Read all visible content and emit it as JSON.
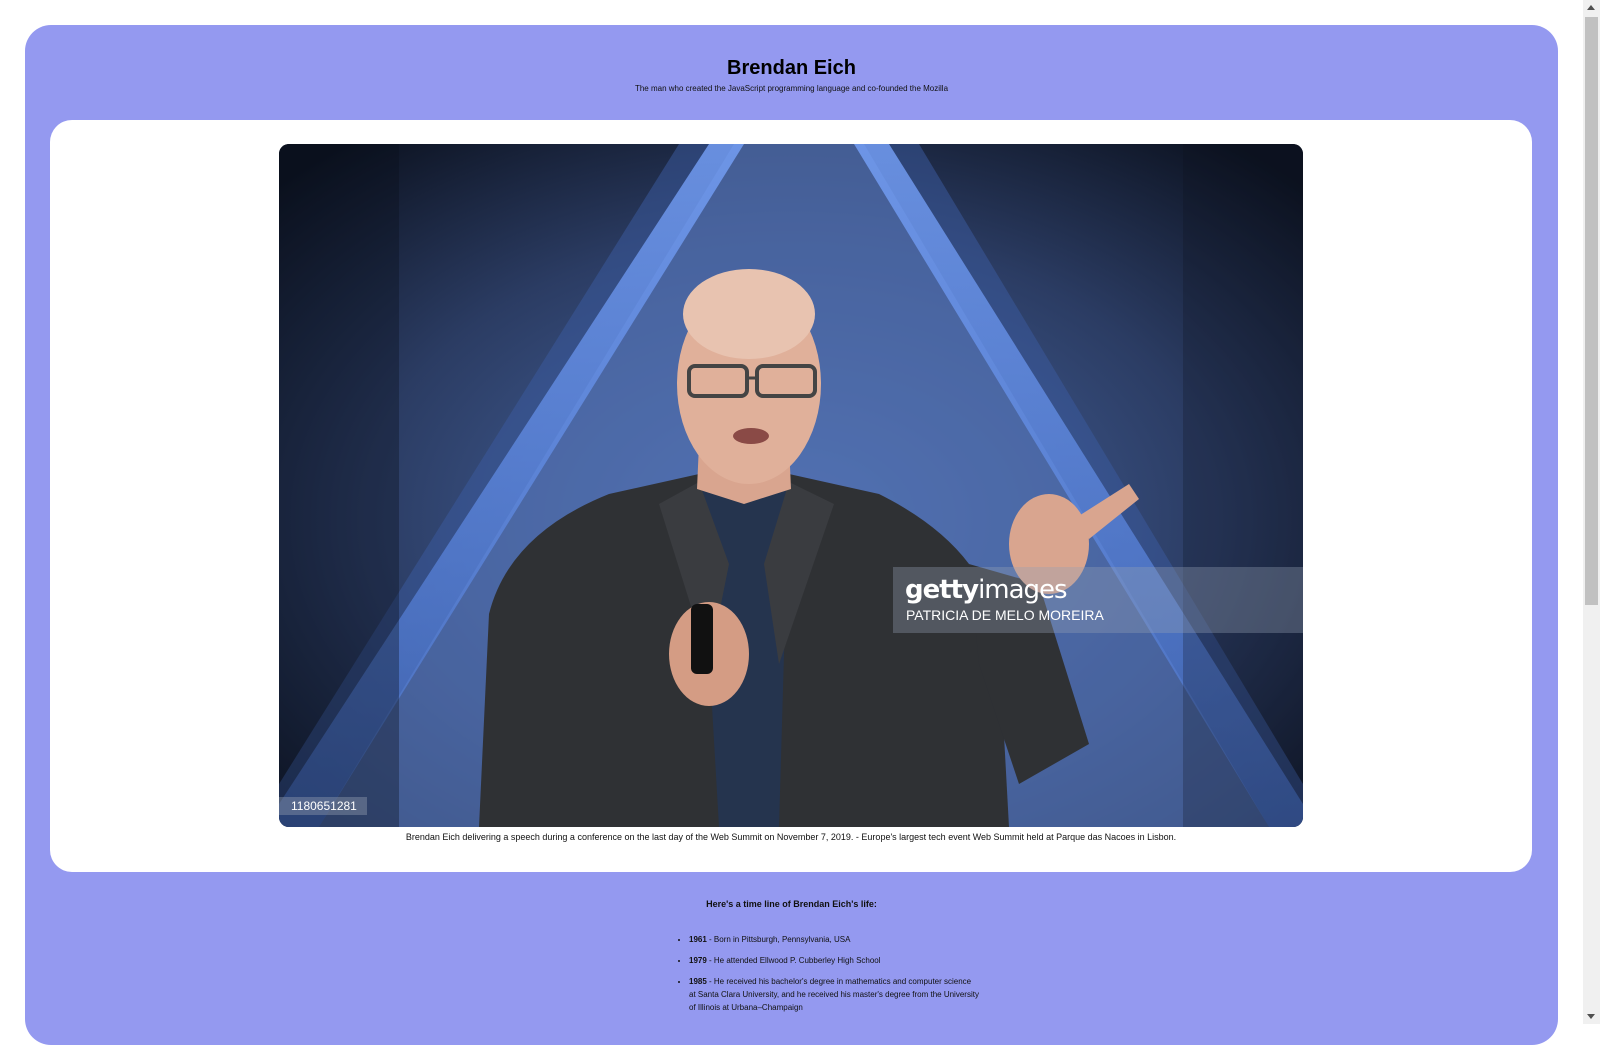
{
  "header": {
    "title": "Brendan Eich",
    "subtitle": "The man who created the JavaScript programming language and co-founded the Mozilla"
  },
  "photo": {
    "watermark_brand_bold": "getty",
    "watermark_brand_rest": "images",
    "watermark_credit": "PATRICIA DE MELO MOREIRA",
    "image_id": "1180651281",
    "caption": "Brendan Eich delivering a speech during a conference on the last day of the Web Summit on November 7, 2019. - Europe's largest tech event Web Summit held at Parque das Nacoes in Lisbon."
  },
  "timeline": {
    "heading": "Here's a time line of Brendan Eich's life:",
    "items": [
      {
        "year": "1961",
        "text": " - Born in Pittsburgh, Pennsylvania, USA"
      },
      {
        "year": "1979",
        "text": " - He attended Ellwood P. Cubberley High School"
      },
      {
        "year": "1985",
        "text": " - He received his bachelor's degree in mathematics and computer science at Santa Clara University, and he received his master's degree from the University of Illinois at Urbana–Champaign"
      }
    ]
  },
  "colors": {
    "page_background": "#9499f0",
    "card_background": "#ffffff"
  }
}
